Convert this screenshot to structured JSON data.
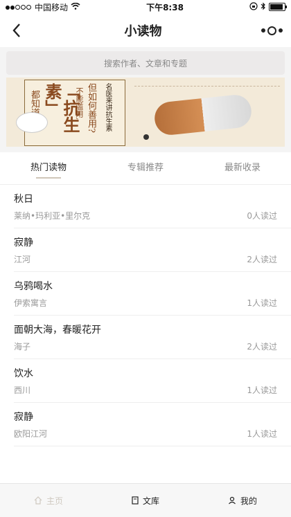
{
  "status": {
    "carrier": "中国移动",
    "time": "下午8:38"
  },
  "nav": {
    "title": "小读物"
  },
  "search": {
    "placeholder": "搜索作者、文章和专题"
  },
  "banner": {
    "poster_chars": [
      "都知道",
      "「抗生素」",
      "但如何善用?",
      "不能滥用,",
      "名医来讲抗生素"
    ]
  },
  "tabs": [
    "热门读物",
    "专辑推荐",
    "最新收录"
  ],
  "items": [
    {
      "title": "秋日",
      "author": "莱纳•玛利亚•里尔克",
      "reads": "0人读过"
    },
    {
      "title": "寂静",
      "author": "江河",
      "reads": "2人读过"
    },
    {
      "title": "乌鸦喝水",
      "author": "伊索寓言",
      "reads": "1人读过"
    },
    {
      "title": "面朝大海，春暖花开",
      "author": "海子",
      "reads": "2人读过"
    },
    {
      "title": "饮水",
      "author": "西川",
      "reads": "1人读过"
    },
    {
      "title": "寂静",
      "author": "欧阳江河",
      "reads": "1人读过"
    }
  ],
  "bottom": {
    "home": "主页",
    "library": "文库",
    "me": "我的"
  },
  "colors": {
    "accent": "#cfc6b8",
    "banner_bg": "#f3ead9"
  }
}
